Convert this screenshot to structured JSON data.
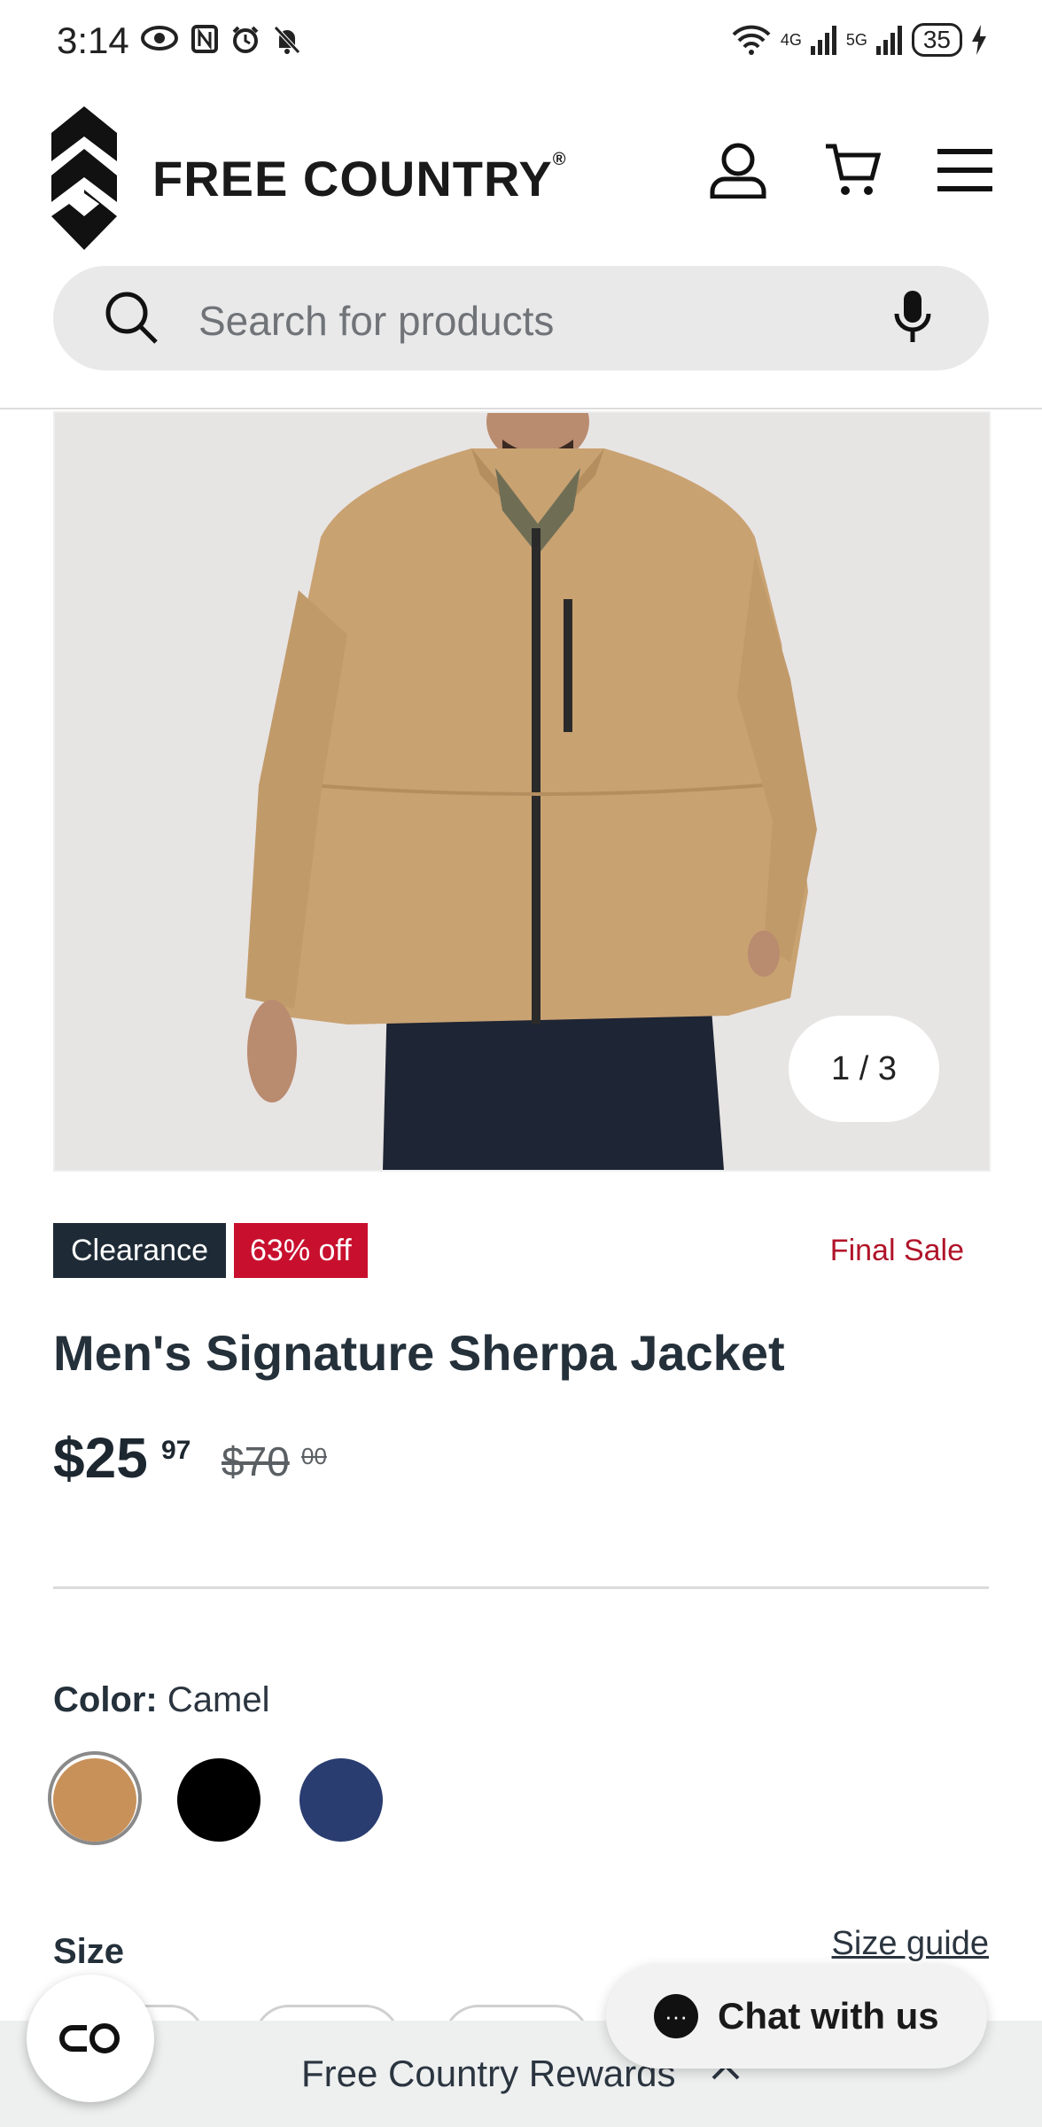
{
  "status_bar": {
    "time": "3:14",
    "network_1": "4G",
    "network_2": "5G",
    "battery": "35"
  },
  "header": {
    "brand": "FREE COUNTRY",
    "brand_mark": "®"
  },
  "search": {
    "placeholder": "Search for products"
  },
  "gallery": {
    "counter": "1 / 3"
  },
  "product": {
    "badge_clearance": "Clearance",
    "badge_discount": "63% off",
    "final_sale": "Final Sale",
    "title": "Men's Signature Sherpa Jacket",
    "price_dollars": "$25",
    "price_cents": "97",
    "was_dollars": "$70",
    "was_cents": "00"
  },
  "color": {
    "label": "Color:",
    "selected": "Camel",
    "swatches": [
      "#c8915a",
      "#000000",
      "#2a3d70"
    ]
  },
  "size": {
    "label": "Size",
    "guide_link": "Size guide"
  },
  "footer": {
    "rewards_label": "Free Country Rewards",
    "chat_label": "Chat with us"
  }
}
